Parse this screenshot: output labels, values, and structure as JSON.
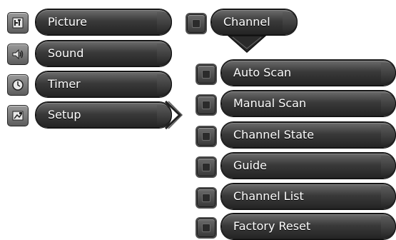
{
  "main_menu": {
    "items": [
      {
        "label": "Picture",
        "icon": "picture-icon"
      },
      {
        "label": "Sound",
        "icon": "speaker-icon"
      },
      {
        "label": "Timer",
        "icon": "clock-icon"
      },
      {
        "label": "Setup",
        "icon": "setup-icon"
      }
    ]
  },
  "submenu": {
    "title": "Channel",
    "items": [
      {
        "label": "Auto Scan"
      },
      {
        "label": "Manual Scan"
      },
      {
        "label": "Channel State"
      },
      {
        "label": "Guide"
      },
      {
        "label": "Channel List"
      },
      {
        "label": "Factory Reset"
      }
    ]
  },
  "colors": {
    "pill_dark": "#242424",
    "pill_light": "#6c6c6c",
    "text": "#ffffff"
  }
}
